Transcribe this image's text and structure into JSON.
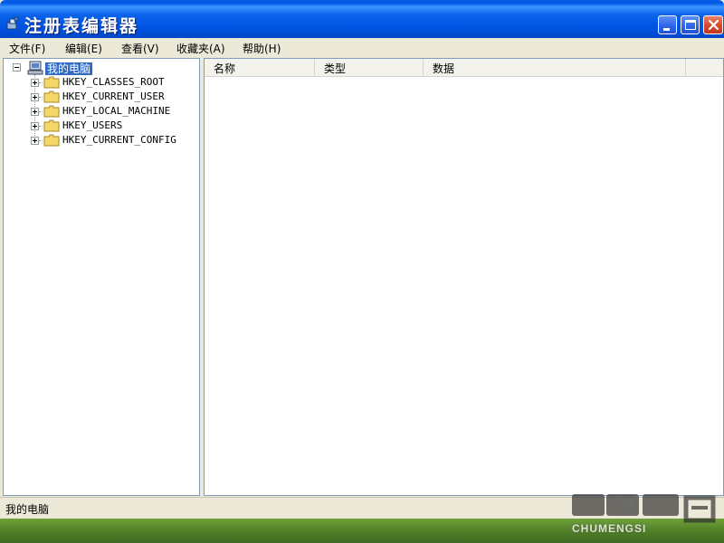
{
  "window": {
    "title": "注册表编辑器"
  },
  "menu": {
    "file": "文件(F)",
    "edit": "编辑(E)",
    "view": "查看(V)",
    "favorites": "收藏夹(A)",
    "help": "帮助(H)"
  },
  "tree": {
    "root": "我的电脑",
    "keys": [
      "HKEY_CLASSES_ROOT",
      "HKEY_CURRENT_USER",
      "HKEY_LOCAL_MACHINE",
      "HKEY_USERS",
      "HKEY_CURRENT_CONFIG"
    ]
  },
  "list": {
    "columns": [
      "名称",
      "类型",
      "数据"
    ]
  },
  "status": {
    "path": "我的电脑"
  },
  "watermark": {
    "brand": "CHUMENGSI"
  },
  "colors": {
    "title_bar": "#0054e3",
    "selection": "#316ac5",
    "chrome": "#ece9d8"
  }
}
